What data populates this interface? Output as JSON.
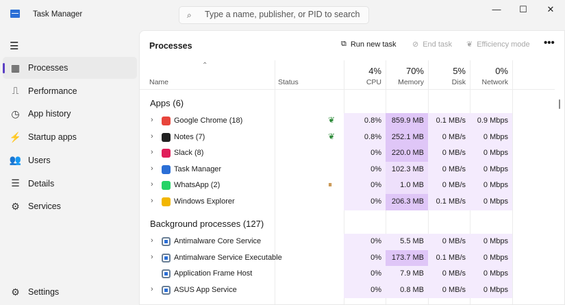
{
  "app": {
    "title": "Task Manager"
  },
  "search": {
    "placeholder": "Type a name, publisher, or PID to search"
  },
  "window_controls": {
    "minimize": "—",
    "maximize": "☐",
    "close": "✕"
  },
  "sidebar": {
    "items": [
      {
        "label": "Processes",
        "icon": "processes-icon",
        "glyph": "▦",
        "active": true
      },
      {
        "label": "Performance",
        "icon": "performance-icon",
        "glyph": "⎍"
      },
      {
        "label": "App history",
        "icon": "app-history-icon",
        "glyph": "◷"
      },
      {
        "label": "Startup apps",
        "icon": "startup-icon",
        "glyph": "⚡"
      },
      {
        "label": "Users",
        "icon": "users-icon",
        "glyph": "👥"
      },
      {
        "label": "Details",
        "icon": "details-icon",
        "glyph": "☰"
      },
      {
        "label": "Services",
        "icon": "services-icon",
        "glyph": "⚙"
      }
    ],
    "settings": "Settings"
  },
  "toolbar": {
    "title": "Processes",
    "run_new_task": "Run new task",
    "end_task": "End task",
    "efficiency_mode": "Efficiency mode",
    "more": "•••"
  },
  "columns": {
    "name": "Name",
    "status": "Status",
    "cpu": {
      "pct": "4%",
      "label": "CPU"
    },
    "memory": {
      "pct": "70%",
      "label": "Memory"
    },
    "disk": {
      "pct": "5%",
      "label": "Disk"
    },
    "network": {
      "pct": "0%",
      "label": "Network"
    }
  },
  "groups": {
    "apps": "Apps (6)",
    "background": "Background processes (127)"
  },
  "apps": [
    {
      "name": "Google Chrome (18)",
      "color": "#e8453c",
      "status": "efficiency",
      "cpu": "0.8%",
      "memory": "859.9 MB",
      "disk": "0.1 MB/s",
      "network": "0.9 Mbps",
      "mem_level": 3
    },
    {
      "name": "Notes (7)",
      "color": "#222222",
      "status": "efficiency",
      "cpu": "0.8%",
      "memory": "252.1 MB",
      "disk": "0 MB/s",
      "network": "0 Mbps",
      "mem_level": 3
    },
    {
      "name": "Slack (8)",
      "color": "#e01e5a",
      "status": "",
      "cpu": "0%",
      "memory": "220.0 MB",
      "disk": "0 MB/s",
      "network": "0 Mbps",
      "mem_level": 3
    },
    {
      "name": "Task Manager",
      "color": "#2b6fd6",
      "status": "",
      "cpu": "0%",
      "memory": "102.3 MB",
      "disk": "0 MB/s",
      "network": "0 Mbps",
      "mem_level": 2
    },
    {
      "name": "WhatsApp (2)",
      "color": "#25d366",
      "status": "suspended",
      "cpu": "0%",
      "memory": "1.0 MB",
      "disk": "0 MB/s",
      "network": "0 Mbps",
      "mem_level": 2
    },
    {
      "name": "Windows Explorer",
      "color": "#f2b600",
      "status": "",
      "cpu": "0%",
      "memory": "206.3 MB",
      "disk": "0.1 MB/s",
      "network": "0 Mbps",
      "mem_level": 3
    }
  ],
  "background": [
    {
      "name": "Antimalware Core Service",
      "expand": true,
      "cpu": "0%",
      "memory": "5.5 MB",
      "disk": "0 MB/s",
      "network": "0 Mbps",
      "mem_level": 1
    },
    {
      "name": "Antimalware Service Executable",
      "expand": true,
      "cpu": "0%",
      "memory": "173.7 MB",
      "disk": "0.1 MB/s",
      "network": "0 Mbps",
      "mem_level": 3
    },
    {
      "name": "Application Frame Host",
      "expand": false,
      "cpu": "0%",
      "memory": "7.9 MB",
      "disk": "0 MB/s",
      "network": "0 Mbps",
      "mem_level": 1
    },
    {
      "name": "ASUS App Service",
      "expand": true,
      "cpu": "0%",
      "memory": "0.8 MB",
      "disk": "0 MB/s",
      "network": "0 Mbps",
      "mem_level": 1
    }
  ]
}
